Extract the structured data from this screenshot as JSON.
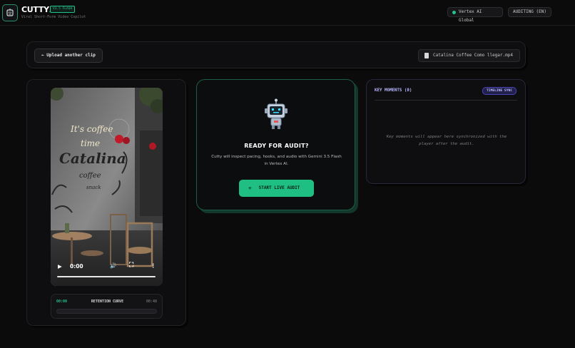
{
  "header": {
    "brand": "CUTTY",
    "brand_suffix": ".AI",
    "version": "V3.5 FLASH",
    "tagline": "Viral Short-Form Video Copilot",
    "region": "Vertex AI Global",
    "mode": "AUDITING (EN)"
  },
  "toolbar": {
    "upload_label": "← Upload another clip",
    "filename": "Catalina Coffee Como llegar.mp4"
  },
  "video": {
    "time": "0:00",
    "progress": 0
  },
  "retention": {
    "start": "00:00",
    "title": "RETENTION CURVE",
    "end": "00:48"
  },
  "audit": {
    "title": "READY FOR AUDIT?",
    "description": "Cutty will inspect pacing, hooks, and audio with Gemini 3.5 Flash in Vertex AI.",
    "button_label": "START LIVE AUDIT"
  },
  "moments": {
    "title": "KEY MOMENTS (0)",
    "badge": "TIMELINE SYNC",
    "empty_text": "Key moments will appear here synchronized with the player after the audit."
  },
  "colors": {
    "accent": "#22c38e",
    "indigo": "#b8b8ff",
    "background": "#0b0b0c"
  }
}
